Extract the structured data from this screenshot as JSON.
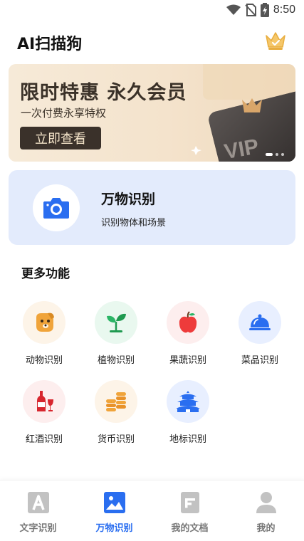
{
  "status_bar": {
    "time": "8:50"
  },
  "header": {
    "title": "AI扫描狗",
    "crown_icon": "crown-icon"
  },
  "banner": {
    "title": "限时特惠 永久会员",
    "subtitle": "一次付费永享特权",
    "button_label": "立即查看",
    "card_text": "VIP"
  },
  "feature": {
    "title": "万物识别",
    "subtitle": "识别物体和场景",
    "icon": "camera-icon"
  },
  "more": {
    "title": "更多功能",
    "items": [
      {
        "label": "动物识别",
        "icon": "dog-icon",
        "color": "#fdf4e8"
      },
      {
        "label": "植物识别",
        "icon": "sprout-icon",
        "color": "#e9f8ef"
      },
      {
        "label": "果蔬识别",
        "icon": "apple-icon",
        "color": "#fdeeee"
      },
      {
        "label": "菜品识别",
        "icon": "dish-cover-icon",
        "color": "#e8efff"
      },
      {
        "label": "红酒识别",
        "icon": "wine-icon",
        "color": "#fdeeee"
      },
      {
        "label": "货币识别",
        "icon": "coins-icon",
        "color": "#fdf4e8"
      },
      {
        "label": "地标识别",
        "icon": "temple-icon",
        "color": "#e8efff"
      }
    ]
  },
  "bottom_nav": [
    {
      "label": "文字识别",
      "icon": "text-a-icon",
      "active": false
    },
    {
      "label": "万物识别",
      "icon": "image-icon",
      "active": true
    },
    {
      "label": "我的文档",
      "icon": "document-icon",
      "active": false
    },
    {
      "label": "我的",
      "icon": "profile-icon",
      "active": false
    }
  ],
  "colors": {
    "accent": "#2a6ef0",
    "banner_button": "#3a312a",
    "feature_card": "#e3ebfc"
  }
}
